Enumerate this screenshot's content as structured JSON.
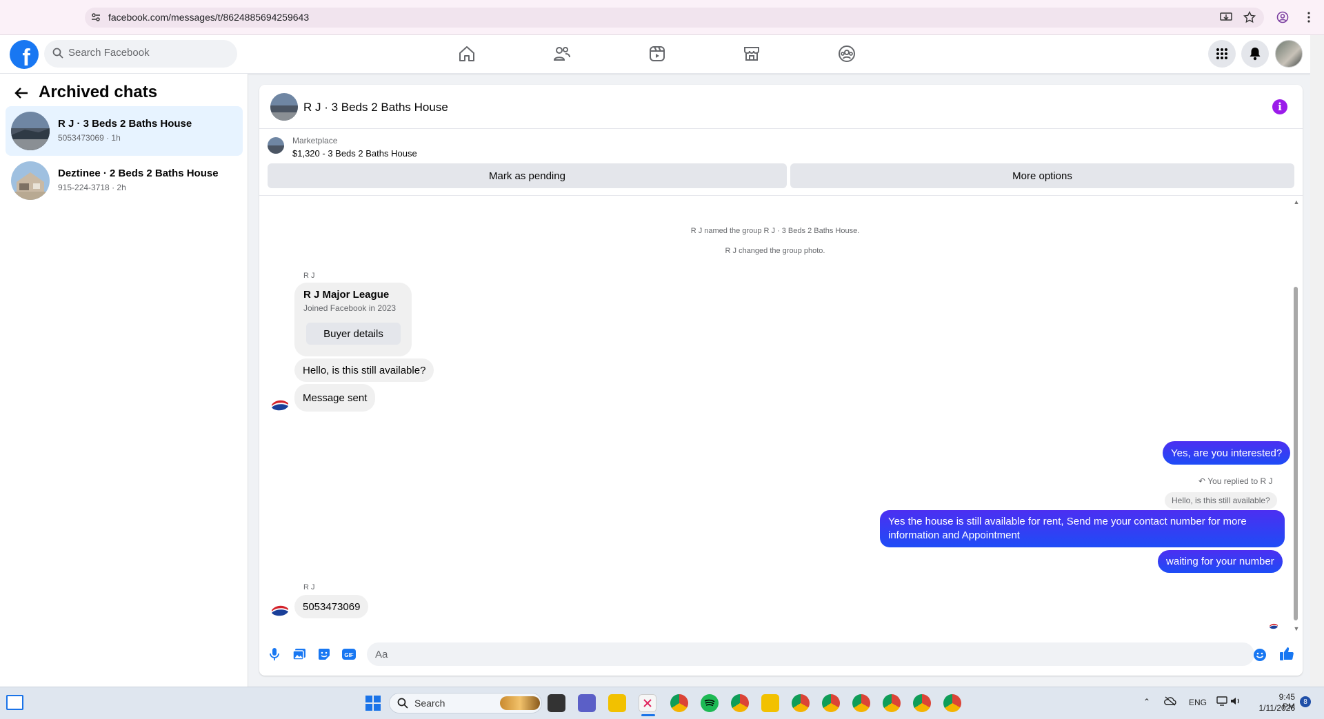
{
  "browser": {
    "url": "facebook.com/messages/t/8624885694259643"
  },
  "fb_nav": {
    "search_placeholder": "Search Facebook",
    "tabs": [
      "home-icon",
      "friends-icon",
      "video-icon",
      "marketplace-icon",
      "groups-icon"
    ],
    "brand_color": "#1877f2"
  },
  "sidebar": {
    "title": "Archived chats",
    "chats": [
      {
        "name": "R J · 3 Beds 2 Baths House",
        "sub": "5053473069 · 1h",
        "active": true
      },
      {
        "name": "Deztinee · 2 Beds 2 Baths House",
        "sub": "915-224-3718 · 2h",
        "active": false
      }
    ]
  },
  "conversation": {
    "title": "R J · 3 Beds 2 Baths House",
    "marketplace_label": "Marketplace",
    "listing": "$1,320 - 3 Beds 2 Baths House",
    "mark_pending_label": "Mark as pending",
    "more_options_label": "More options",
    "system_messages": [
      "R J named the group R J · 3 Beds 2 Baths House.",
      "R J changed the group photo."
    ],
    "sender_name": "R J",
    "profile_card": {
      "name": "R J Major League",
      "joined": "Joined Facebook in 2023",
      "button": "Buyer details"
    },
    "incoming_1": "Hello, is this still available?",
    "incoming_2": "Message sent",
    "outgoing_1": "Yes, are you interested?",
    "reply_note": "You replied to R J",
    "reply_quote": "Hello, is this still available?",
    "outgoing_2": "Yes the house is still available for rent, Send me your contact number for more information and Appointment",
    "outgoing_3": "waiting for your number",
    "incoming_3": "5053473069",
    "composer_placeholder": "Aa",
    "outgoing_color": "#3a2bf2"
  },
  "taskbar": {
    "search_label": "Search",
    "language": "ENG",
    "time": "9:45 PM",
    "date": "1/11/2026",
    "notification_count": "8"
  }
}
